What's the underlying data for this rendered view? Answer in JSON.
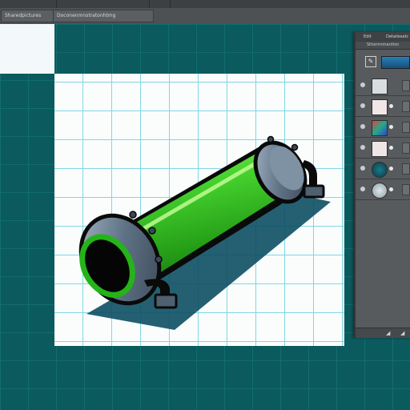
{
  "app": {
    "menu_tab_1": "Sharedpictures",
    "menu_tab_2": "Doconenmnstratonhtmg"
  },
  "panel": {
    "tab_1": "Edit",
    "tab_2": "Detailesatc",
    "subheader": "Sthernnmantion"
  },
  "icons": {
    "pen": "pen-icon",
    "visibility": "eye-icon",
    "new_layer": "new-layer-icon",
    "collapse": "collapse-icon"
  },
  "colors": {
    "workspace": "#0b5a5e",
    "canvas_grid": "#7fd7e4",
    "pipe_green": "#39c82a",
    "pipe_metal": "#5a6e80",
    "panel": "#585b5e"
  }
}
